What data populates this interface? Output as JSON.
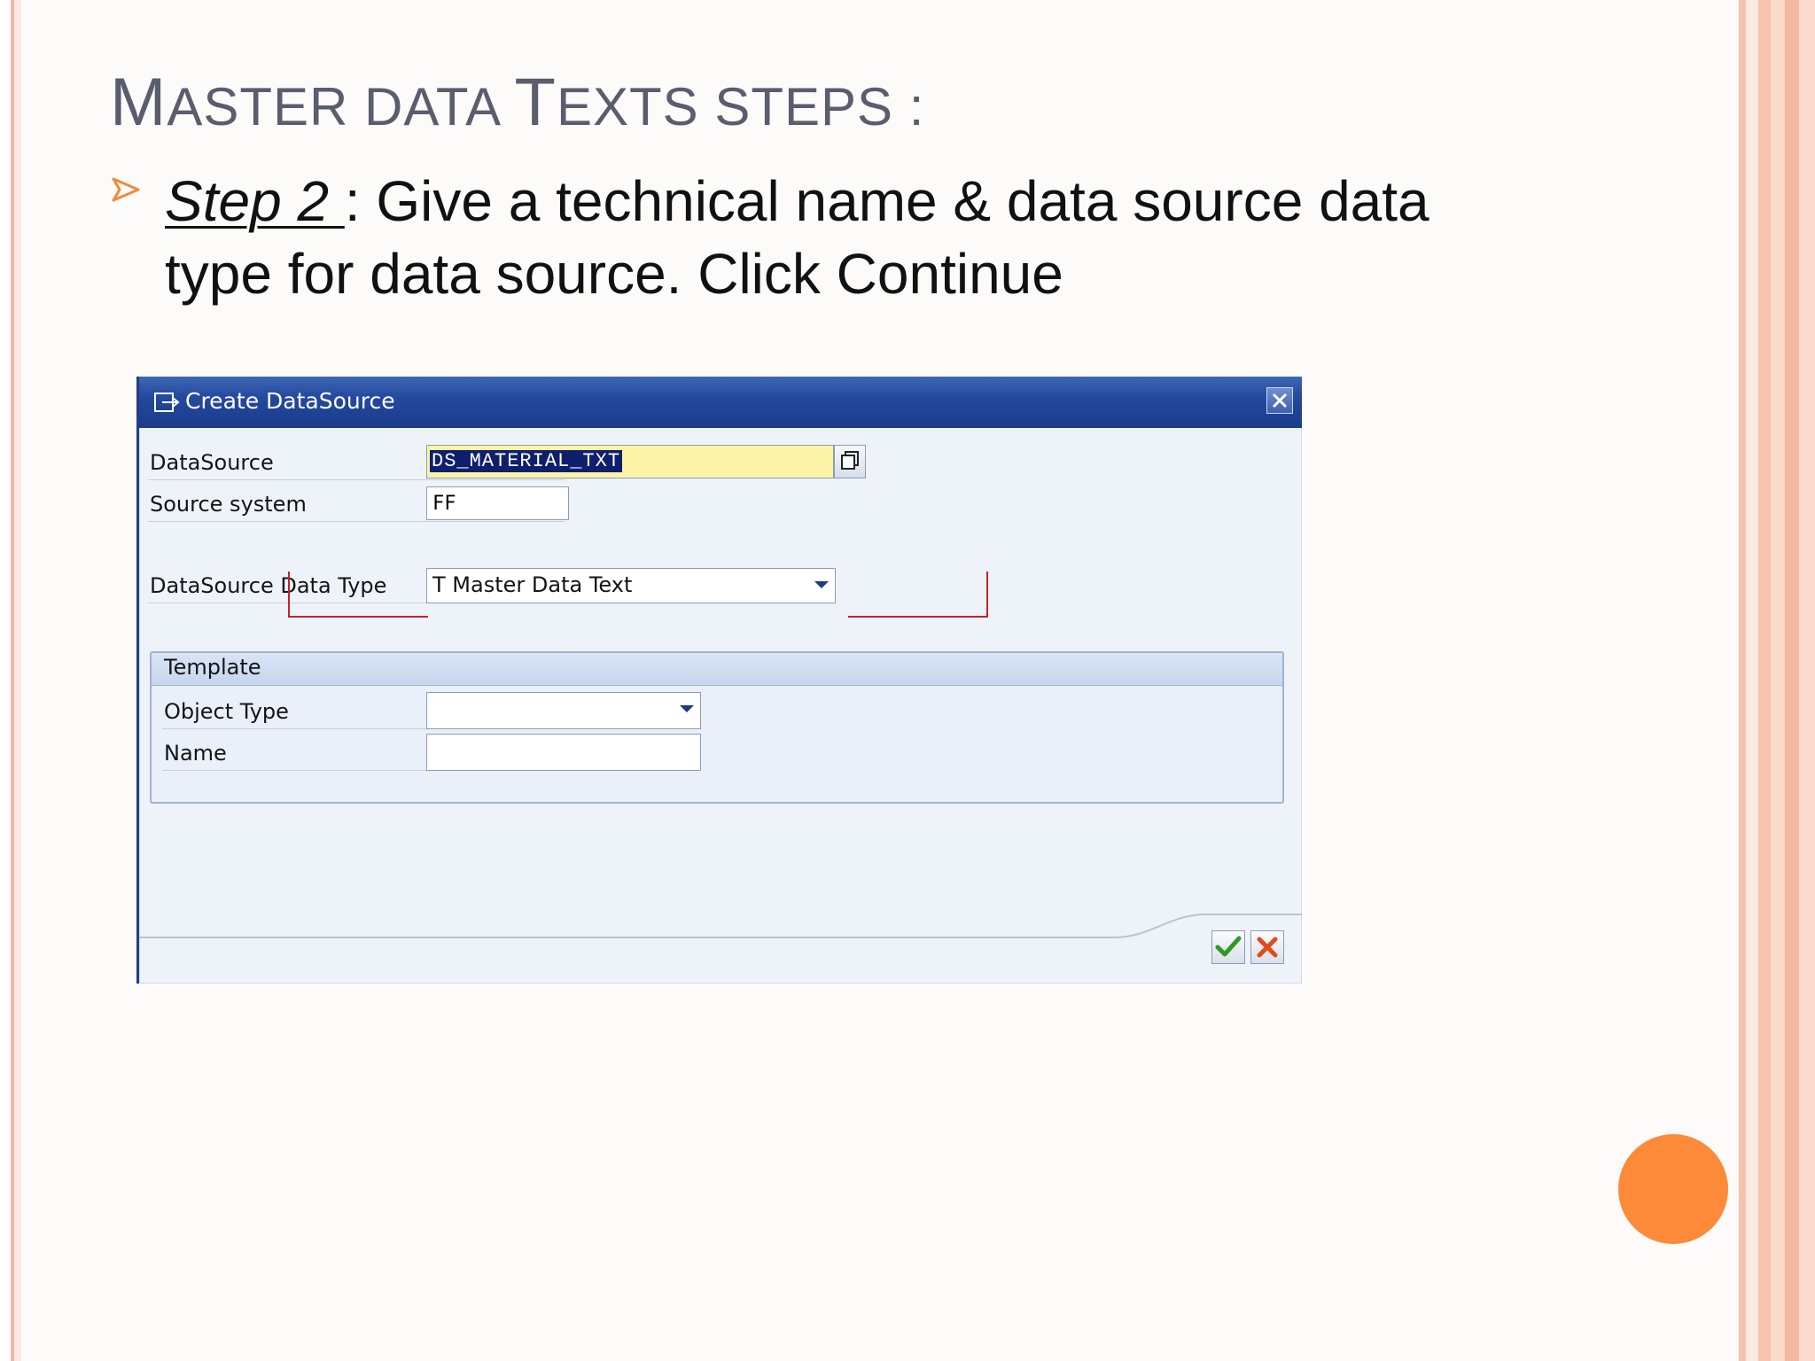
{
  "slide": {
    "title_first_letter": "M",
    "title_part1": "ASTER DATA ",
    "title_second_letter": "T",
    "title_part2": "EXTS STEPS :",
    "bullet_step": "Step 2 ",
    "bullet_text": ": Give a technical name & data source data type for data source. Click Continue"
  },
  "dialog": {
    "title": "Create DataSource",
    "fields": {
      "datasource_label": "DataSource",
      "datasource_value": "DS_MATERIAL_TXT",
      "source_system_label": "Source system",
      "source_system_value": "FF",
      "data_type_label": "DataSource Data Type",
      "data_type_value": "T Master Data Text"
    },
    "template": {
      "heading": "Template",
      "object_type_label": "Object Type",
      "object_type_value": "",
      "name_label": "Name",
      "name_value": ""
    }
  },
  "colors": {
    "title_text": "#5a5d6e",
    "accent_orange": "#fd8a39",
    "dialog_titlebar": "#24499e",
    "highlight_field": "#fdf3a6",
    "annotation_red": "#c8202a"
  },
  "icons": {
    "bullet": "arrow-bullet-icon",
    "dialog": "create-datasource-icon",
    "close": "close-icon",
    "copy": "copy-icon",
    "continue": "checkmark-icon",
    "cancel": "cancel-x-icon"
  }
}
